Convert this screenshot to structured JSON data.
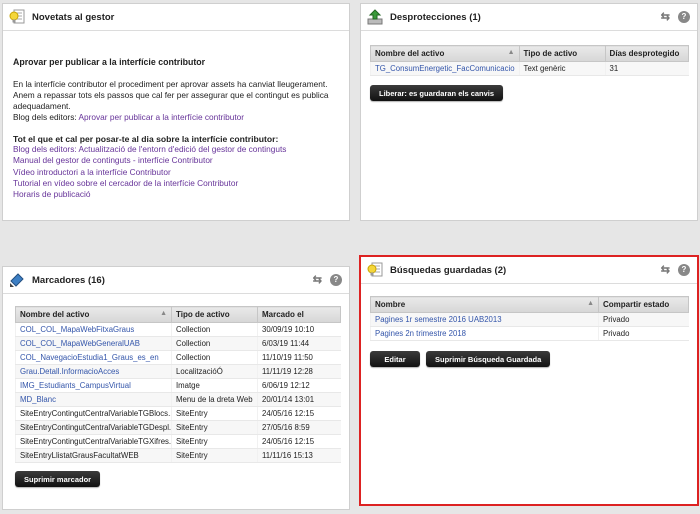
{
  "news": {
    "title": "Novetats al gestor",
    "heading1": "Aprovar per publicar a la interfície contributor",
    "para": "En la interfície contributor el procediment per aprovar assets ha canviat lleugerament. Anem a repassar tots els passos que cal fer per assegurar que el contingut es publica adequadament.",
    "blog_prefix": "Blog dels editors: ",
    "blog_link": "Aprovar per publicar a la interfície contributor",
    "heading2": "Tot el que et cal per posar-te al dia sobre la interfície contributor:",
    "links": [
      "Blog dels editors: Actualització de l'entorn d'edició del gestor de continguts",
      "Manual del gestor de continguts - interfície Contributor",
      "Vídeo introductori a la interfície Contributor",
      "Tutorial en vídeo sobre el cercador de la interfície Contributor",
      "Horaris de publicació"
    ]
  },
  "desprotecciones": {
    "title": "Desprotecciones (1)",
    "columns": [
      "Nombre del activo",
      "Tipo de activo",
      "Días desprotegido"
    ],
    "rows": [
      [
        "TG_ConsumEnergetic_FacComunicacio",
        "Text genèric",
        "31"
      ]
    ],
    "button": "Liberar: es guardaran els canvis"
  },
  "marcadores": {
    "title": "Marcadores (16)",
    "columns": [
      "Nombre del activo",
      "Tipo de activo",
      "Marcado el"
    ],
    "rows": [
      [
        "COL_COL_MapaWebFitxaGraus",
        "Collection",
        "30/09/19 10:10",
        true
      ],
      [
        "COL_COL_MapaWebGeneralUAB",
        "Collection",
        "6/03/19 11:44",
        true
      ],
      [
        "COL_NavegacioEstudia1_Graus_es_en",
        "Collection",
        "11/10/19 11:50",
        true
      ],
      [
        "Grau.Detall.InformacioAcces",
        "LocalitzacióÓ",
        "11/11/19 12:28",
        true
      ],
      [
        "IMG_Estudiants_CampusVirtual",
        "Imatge",
        "6/06/19 12:12",
        true
      ],
      [
        "MD_Blanc",
        "Menu de la dreta Web",
        "20/01/14 13:01",
        true
      ],
      [
        "SiteEntryContingutCentralVariableTGBlocs...",
        "SiteEntry",
        "24/05/16 12:15",
        false
      ],
      [
        "SiteEntryContingutCentralVariableTGDespl...",
        "SiteEntry",
        "27/05/16 8:59",
        false
      ],
      [
        "SiteEntryContingutCentralVariableTGXifres...",
        "SiteEntry",
        "24/05/16 12:15",
        false
      ],
      [
        "SiteEntryLlistatGrausFacultatWEB",
        "SiteEntry",
        "11/11/16 15:13",
        false
      ]
    ],
    "button": "Suprimir marcador"
  },
  "busquedas": {
    "title": "Búsquedas guardadas (2)",
    "columns": [
      "Nombre",
      "Compartir estado"
    ],
    "rows": [
      [
        "Pagines 1r semestre 2016 UAB2013",
        "Privado"
      ],
      [
        "Pagines 2n trimestre 2018",
        "Privado"
      ]
    ],
    "button_edit": "Editar",
    "button_delete": "Suprimir Búsqueda Guardada"
  },
  "colors": {
    "link": "#3355aa",
    "visited": "#663399",
    "highlight": "#dd2222"
  }
}
